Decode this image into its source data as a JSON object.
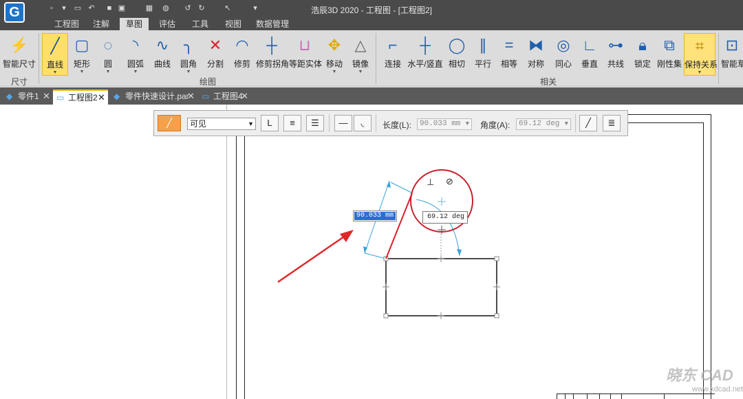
{
  "titlebar": {
    "title": "浩辰3D 2020 - 工程图 - [工程图2]",
    "logo": "G"
  },
  "menu": {
    "tabs": [
      "工程图",
      "注解",
      "草图",
      "评估",
      "工具",
      "视图",
      "数据管理"
    ],
    "active_tab": "草图"
  },
  "ribbon": {
    "buttons": {
      "smart_dim": "智能尺寸",
      "line": "直线",
      "rect": "矩形",
      "circle": "圆",
      "arc": "圆弧",
      "curve": "曲线",
      "fillet": "圆角",
      "split": "分割",
      "trim": "修剪",
      "trim_corner": "修剪拐角",
      "offset": "等距实体",
      "move": "移动",
      "mirror": "镜像",
      "connect": "连接",
      "horiz_vert": "水平/竖直",
      "tangent": "相切",
      "parallel": "平行",
      "equal": "相等",
      "symmetric": "对称",
      "concentric": "同心",
      "perpendicular": "垂直",
      "collinear": "共线",
      "lock": "锁定",
      "rigid_set": "刚性集",
      "maintain": "保持关系",
      "smart_sketch": "智能草"
    },
    "groups": {
      "dimension": "尺寸",
      "draw": "绘图",
      "relate": "相关"
    }
  },
  "doc_tabs": [
    {
      "label": "零件1",
      "icon": "part-icon"
    },
    {
      "label": "工程图2",
      "icon": "drawing-icon",
      "active": true
    },
    {
      "label": "零件快速设计.par",
      "icon": "part-icon"
    },
    {
      "label": "工程图4",
      "icon": "drawing-icon"
    }
  ],
  "command_bar": {
    "style_value": "可见",
    "length_label": "长度(L):",
    "length_value": "90.033 mm",
    "angle_label": "角度(A):",
    "angle_value": "69.12 deg"
  },
  "canvas": {
    "length_input": "90.033 mm",
    "angle_readout": "69.12 deg"
  },
  "watermark": {
    "text": "晓东 CAD",
    "url": "www.xdcad.net"
  },
  "colors": {
    "accent_active": "#ffdf6a",
    "sketch_line": "#d8202a",
    "dimension": "#3aa0d8",
    "annotation_arrow": "#e0282a"
  }
}
